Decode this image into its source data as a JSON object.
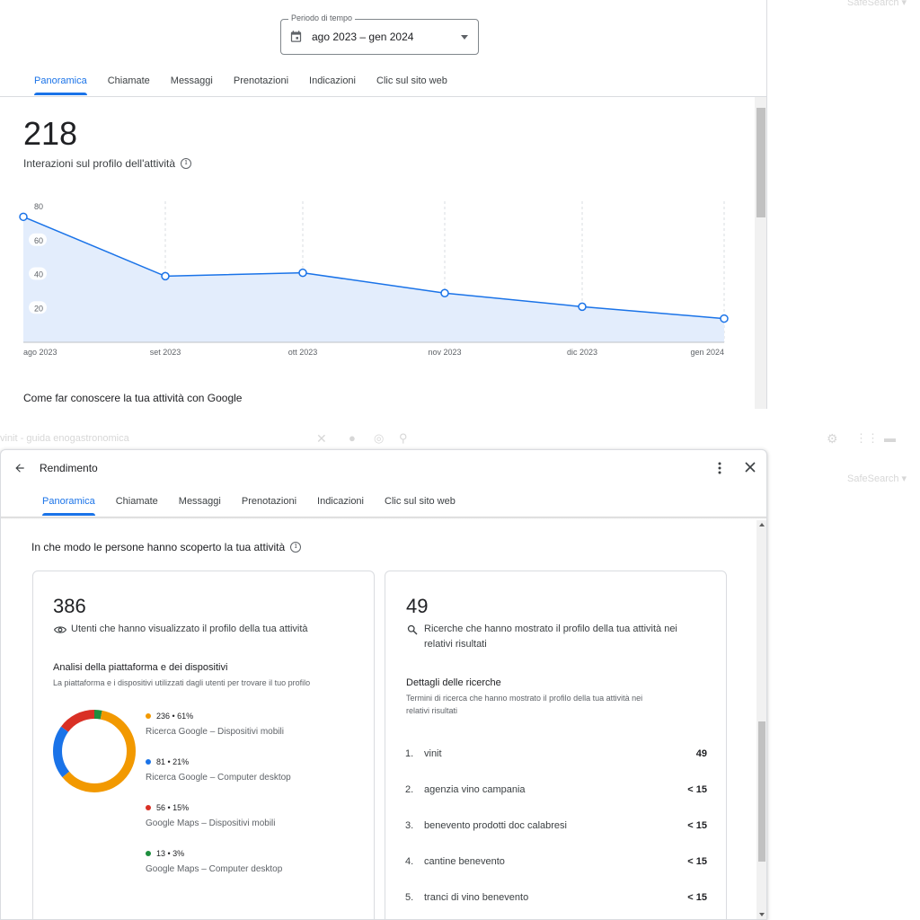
{
  "background": {
    "faded_right_top": "SafeSearch ▾",
    "faded_right_mid": "SafeSearch ▾",
    "faded_search_text": "vinit - guida enogastronomica"
  },
  "top_panel": {
    "period": {
      "legend": "Periodo di tempo",
      "value": "ago 2023 – gen 2024",
      "icon": "calendar-icon"
    },
    "tabs": [
      {
        "label": "Panoramica",
        "active": true
      },
      {
        "label": "Chiamate",
        "active": false
      },
      {
        "label": "Messaggi",
        "active": false
      },
      {
        "label": "Prenotazioni",
        "active": false
      },
      {
        "label": "Indicazioni",
        "active": false
      },
      {
        "label": "Clic sul sito web",
        "active": false
      }
    ],
    "total": "218",
    "total_label": "Interazioni sul profilo dell'attività",
    "next_section": "Come far conoscere la tua attività con Google"
  },
  "chart_data": {
    "type": "area",
    "x": [
      "ago 2023",
      "set 2023",
      "ott 2023",
      "nov 2023",
      "dic 2023",
      "gen 2024"
    ],
    "series": [
      {
        "values": [
          74,
          39,
          41,
          29,
          21,
          14
        ]
      }
    ],
    "y_ticks": [
      20,
      40,
      60,
      80
    ],
    "ylim": [
      0,
      80
    ],
    "grid": "vertical dashed",
    "line_color": "#1a73e8",
    "fill_color": "#e3edfc"
  },
  "dialog": {
    "title": "Rendimento",
    "tabs": [
      {
        "label": "Panoramica",
        "active": true
      },
      {
        "label": "Chiamate",
        "active": false
      },
      {
        "label": "Messaggi",
        "active": false
      },
      {
        "label": "Prenotazioni",
        "active": false
      },
      {
        "label": "Indicazioni",
        "active": false
      },
      {
        "label": "Clic sul sito web",
        "active": false
      }
    ],
    "section_heading": "In che modo le persone hanno scoperto la tua attività",
    "left_card": {
      "number": "386",
      "label": "Utenti che hanno visualizzato il profilo della tua attività",
      "icon": "eye-icon",
      "sub_title": "Analisi della piattaforma e dei dispositivi",
      "sub_desc": "La piattaforma e i dispositivi utilizzati dagli utenti per trovare il tuo profilo",
      "donut": [
        {
          "top": "236 • 61%",
          "bottom": "Ricerca Google – Dispositivi mobili",
          "color": "#f29900",
          "share": 61
        },
        {
          "top": "81 • 21%",
          "bottom": "Ricerca Google – Computer desktop",
          "color": "#1a73e8",
          "share": 21
        },
        {
          "top": "56 • 15%",
          "bottom": "Google Maps – Dispositivi mobili",
          "color": "#d93025",
          "share": 15
        },
        {
          "top": "13 • 3%",
          "bottom": "Google Maps – Computer desktop",
          "color": "#1e8e3e",
          "share": 3
        }
      ]
    },
    "right_card": {
      "number": "49",
      "label_line1": "Ricerche che hanno mostrato il profilo della tua attività nei",
      "label_line2": "relativi risultati",
      "icon": "search-icon",
      "sub_title": "Dettagli delle ricerche",
      "sub_desc_line1": "Termini di ricerca che hanno mostrato il profilo della tua attività nei",
      "sub_desc_line2": "relativi risultati",
      "rows": [
        {
          "rank": "1.",
          "term": "vinit",
          "count": "49"
        },
        {
          "rank": "2.",
          "term": "agenzia vino campania",
          "count": "< 15"
        },
        {
          "rank": "3.",
          "term": "benevento prodotti doc calabresi",
          "count": "< 15"
        },
        {
          "rank": "4.",
          "term": "cantine benevento",
          "count": "< 15"
        },
        {
          "rank": "5.",
          "term": "tranci di vino benevento",
          "count": "< 15"
        }
      ]
    }
  }
}
